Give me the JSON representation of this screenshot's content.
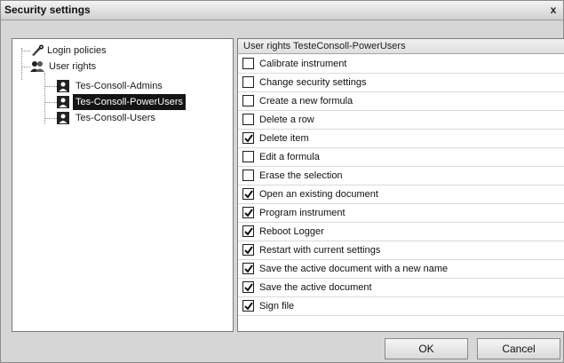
{
  "window": {
    "title": "Security settings",
    "close_label": "x"
  },
  "tree": {
    "login_policies": "Login policies",
    "user_rights": "User rights",
    "users": [
      {
        "label": "Tes-Consoll-Admins",
        "selected": false
      },
      {
        "label": "Tes-Consoll-PowerUsers",
        "selected": true
      },
      {
        "label": "Tes-Consoll-Users",
        "selected": false
      }
    ]
  },
  "permissions": {
    "header": "User rights TesteConsoll-PowerUsers",
    "items": [
      {
        "label": "Calibrate instrument",
        "checked": false
      },
      {
        "label": "Change security settings",
        "checked": false
      },
      {
        "label": "Create a new formula",
        "checked": false
      },
      {
        "label": "Delete a row",
        "checked": false
      },
      {
        "label": "Delete item",
        "checked": true
      },
      {
        "label": "Edit a formula",
        "checked": false
      },
      {
        "label": "Erase the selection",
        "checked": false
      },
      {
        "label": "Open an existing document",
        "checked": true
      },
      {
        "label": "Program instrument",
        "checked": true
      },
      {
        "label": "Reboot Logger",
        "checked": true
      },
      {
        "label": "Restart with current settings",
        "checked": true
      },
      {
        "label": "Save the active document with a new name",
        "checked": true
      },
      {
        "label": "Save the active document",
        "checked": true
      },
      {
        "label": "Sign file",
        "checked": true
      }
    ]
  },
  "buttons": {
    "ok": "OK",
    "cancel": "Cancel"
  }
}
